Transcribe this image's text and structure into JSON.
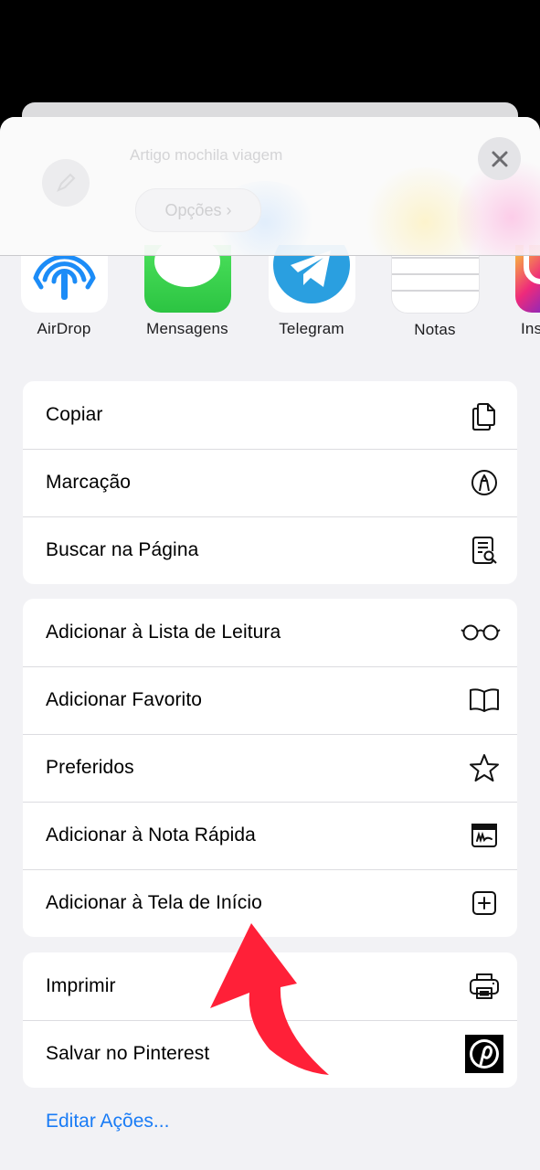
{
  "header": {
    "title": "Artigo mochila viagem",
    "options_label": "Opções ›"
  },
  "apps": [
    {
      "label": "AirDrop",
      "icon": "airdrop-icon"
    },
    {
      "label": "Mensagens",
      "icon": "messages-icon"
    },
    {
      "label": "Telegram",
      "icon": "telegram-icon"
    },
    {
      "label": "Notas",
      "icon": "notes-icon"
    },
    {
      "label": "Ins",
      "icon": "instagram-icon"
    }
  ],
  "group1": [
    {
      "label": "Copiar",
      "icon": "copy-icon"
    },
    {
      "label": "Marcação",
      "icon": "markup-icon"
    },
    {
      "label": "Buscar na Página",
      "icon": "find-on-page-icon"
    }
  ],
  "group2": [
    {
      "label": "Adicionar à Lista de Leitura",
      "icon": "glasses-icon"
    },
    {
      "label": "Adicionar Favorito",
      "icon": "book-icon"
    },
    {
      "label": "Preferidos",
      "icon": "star-icon"
    },
    {
      "label": "Adicionar à Nota Rápida",
      "icon": "quick-note-icon"
    },
    {
      "label": "Adicionar à Tela de Início",
      "icon": "add-square-icon"
    }
  ],
  "group3": [
    {
      "label": "Imprimir",
      "icon": "printer-icon"
    },
    {
      "label": "Salvar no Pinterest",
      "icon": "pinterest-icon"
    }
  ],
  "edit_actions": "Editar Ações...",
  "colors": {
    "accent": "#1a7cf5",
    "annotation_arrow": "#ff2038"
  }
}
